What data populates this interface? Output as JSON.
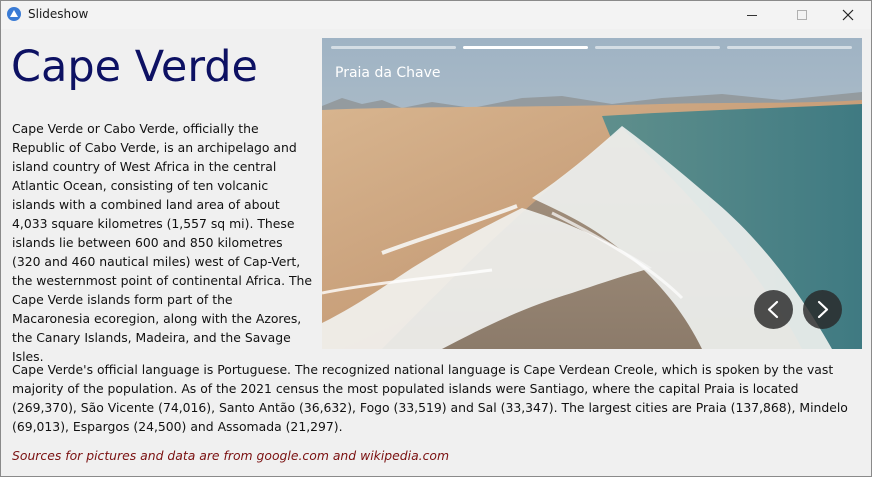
{
  "window": {
    "title": "Slideshow"
  },
  "heading": "Cape Verde",
  "description_1": "Cape Verde or Cabo Verde, officially the Republic of Cabo Verde, is an archipelago and island country of West Africa in the central Atlantic Ocean, consisting of ten volcanic islands with a combined land area of about 4,033 square kilometres (1,557 sq mi). These islands lie between 600 and 850 kilometres (320 and 460 nautical miles) west of Cap-Vert, the westernmost point of continental Africa. The Cape Verde islands form part of the Macaronesia ecoregion, along with the Azores, the Canary Islands, Madeira, and the Savage Isles.",
  "description_2": "Cape Verde's official language is Portuguese. The recognized national language is Cape Verdean Creole, which is spoken by the vast majority of the population. As of the 2021 census the most populated islands were Santiago, where the capital Praia is located (269,370), São Vicente (74,016), Santo Antão (36,632), Fogo (33,519) and Sal (33,347). The largest cities are Praia (137,868), Mindelo (69,013), Espargos (24,500) and Assomada (21,297).",
  "sources": "Sources for pictures and data are from google.com and wikipedia.com",
  "slideshow": {
    "caption": "Praia da Chave",
    "slide_count": 4,
    "active_index": 1
  },
  "icons": {
    "app": "app-logo-icon",
    "minimize": "minimize-icon",
    "maximize": "maximize-icon",
    "close": "close-icon",
    "previous": "chevron-left-icon",
    "next": "chevron-right-icon"
  },
  "colors": {
    "heading": "#0d1163",
    "sources": "#7a1010",
    "progress_active": "#ffffff",
    "nav_button": "#282828"
  }
}
